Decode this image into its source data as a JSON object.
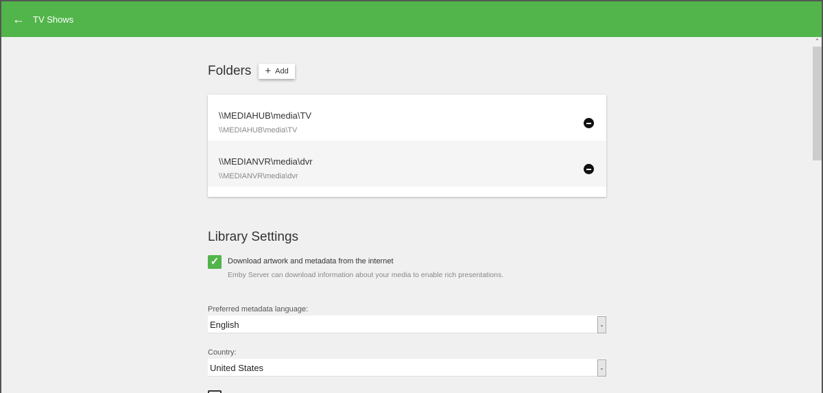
{
  "header": {
    "title": "TV Shows",
    "back_icon": "arrow-left-icon"
  },
  "folders": {
    "title": "Folders",
    "add_label": "Add",
    "items": [
      {
        "path": "\\\\MEDIAHUB\\media\\TV",
        "subtitle": "\\\\MEDIAHUB\\media\\TV"
      },
      {
        "path": "\\\\MEDIANVR\\media\\dvr",
        "subtitle": "\\\\MEDIANVR\\media\\dvr"
      }
    ]
  },
  "library": {
    "title": "Library Settings",
    "download": {
      "label": "Download artwork and metadata from the internet",
      "description": "Emby Server can download information about your media to enable rich presentations.",
      "checked": true
    },
    "language": {
      "label": "Preferred metadata language:",
      "value": "English"
    },
    "country": {
      "label": "Country:",
      "value": "United States"
    }
  },
  "colors": {
    "accent": "#52b54b"
  }
}
